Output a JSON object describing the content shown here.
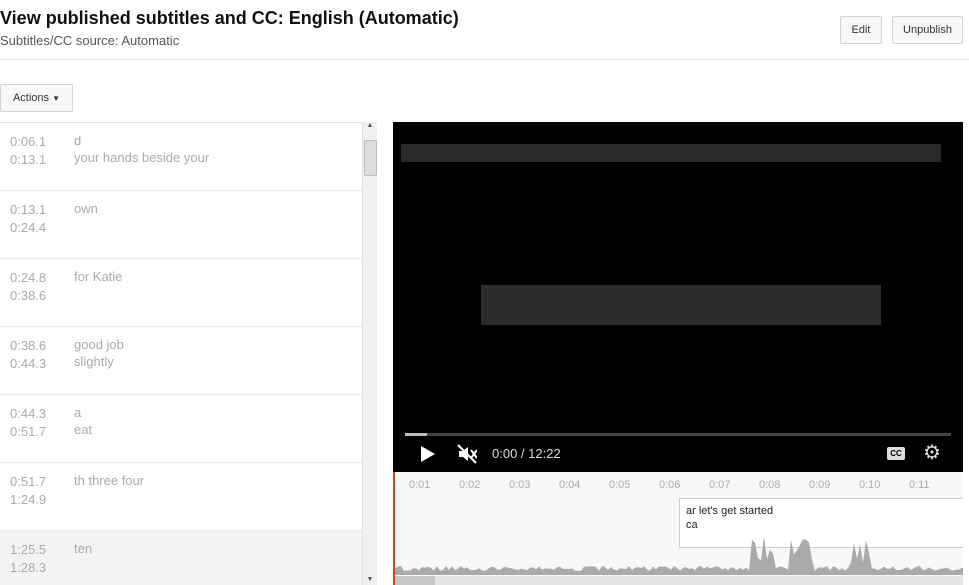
{
  "header": {
    "title": "View published subtitles and CC: English (Automatic)",
    "subtitle": "Subtitles/CC source: Automatic",
    "edit": "Edit",
    "unpublish": "Unpublish"
  },
  "actions": "Actions",
  "captions": [
    {
      "start": "0:06.1",
      "end": "0:13.1",
      "line1": "d",
      "line2": "your hands beside your"
    },
    {
      "start": "0:13.1",
      "end": "0:24.4",
      "line1": "own",
      "line2": ""
    },
    {
      "start": "0:24.8",
      "end": "0:38.6",
      "line1": "for Katie",
      "line2": ""
    },
    {
      "start": "0:38.6",
      "end": "0:44.3",
      "line1": "good job",
      "line2": "slightly"
    },
    {
      "start": "0:44.3",
      "end": "0:51.7",
      "line1": "a",
      "line2": "eat"
    },
    {
      "start": "0:51.7",
      "end": "1:24.9",
      "line1": "th three four",
      "line2": ""
    },
    {
      "start": "1:25.5",
      "end": "1:28.3",
      "line1": "ten",
      "line2": ""
    }
  ],
  "player": {
    "time": "0:00 / 12:22",
    "progress_fraction": 0.0,
    "muted": true
  },
  "timeline": {
    "ticks": [
      "0:01",
      "0:02",
      "0:03",
      "0:04",
      "0:05",
      "0:06",
      "0:07",
      "0:08",
      "0:09",
      "0:10",
      "0:11"
    ],
    "caption_line1": "ar let's get started",
    "caption_line2": "ca"
  },
  "colors": {
    "playhead": "#d04a18",
    "video_bg": "#000000"
  }
}
